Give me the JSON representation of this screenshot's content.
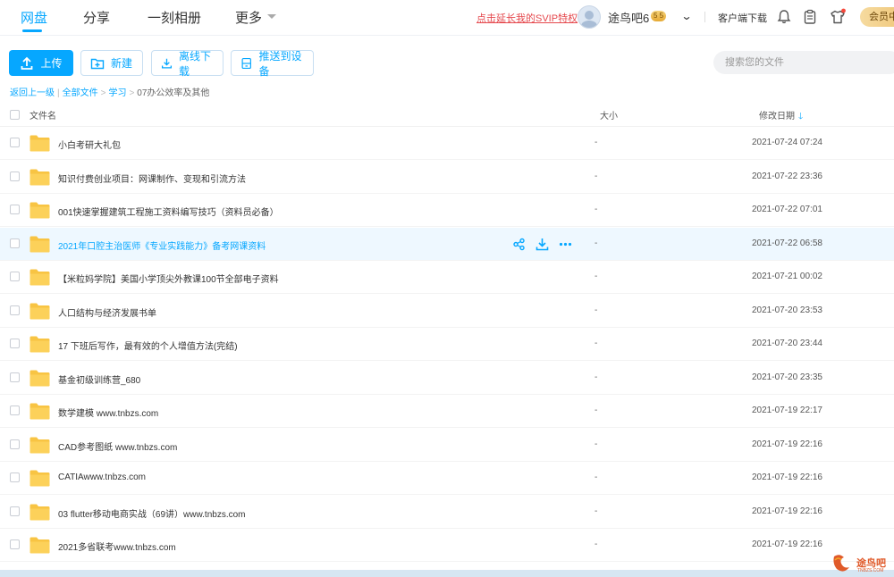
{
  "nav": {
    "items": [
      {
        "label": "网盘",
        "active": true
      },
      {
        "label": "分享",
        "active": false
      },
      {
        "label": "一刻相册",
        "active": false
      },
      {
        "label": "更多",
        "active": false
      }
    ]
  },
  "header": {
    "svip_promo": "点击延长我的SVIP特权",
    "username": "途鸟吧6",
    "vip_level": "5 5",
    "client_download": "客户端下载",
    "member_button": "会员中"
  },
  "toolbar": {
    "upload": "上传",
    "new_folder": "新建",
    "offline_download": "离线下载",
    "push_to_device": "推送到设备",
    "search_placeholder": "搜索您的文件"
  },
  "breadcrumb": {
    "back": "返回上一级",
    "all_files": "全部文件",
    "level1": "学习",
    "current": "07办公效率及其他"
  },
  "table": {
    "col_name": "文件名",
    "col_size": "大小",
    "col_date": "修改日期",
    "rows": [
      {
        "name": "小白考研大礼包",
        "size": "-",
        "date": "2021-07-24 07:24"
      },
      {
        "name": "知识付费创业项目：网课制作、变现和引流方法",
        "size": "-",
        "date": "2021-07-22 23:36"
      },
      {
        "name": "001快速掌握建筑工程施工资料编写技巧（资料员必备）",
        "size": "-",
        "date": "2021-07-22 07:01"
      },
      {
        "name": "2021年口腔主治医师《专业实践能力》备考网课资料",
        "size": "-",
        "date": "2021-07-22 06:58"
      },
      {
        "name": "【米粒妈学院】美国小学顶尖外教课100节全部电子资料",
        "size": "-",
        "date": "2021-07-21 00:02"
      },
      {
        "name": "人口结构与经济发展书单",
        "size": "-",
        "date": "2021-07-20 23:53"
      },
      {
        "name": "17 下班后写作，最有效的个人增值方法(完结)",
        "size": "-",
        "date": "2021-07-20 23:44"
      },
      {
        "name": "基金初级训练营_680",
        "size": "-",
        "date": "2021-07-20 23:35"
      },
      {
        "name": "数学建模 www.tnbzs.com",
        "size": "-",
        "date": "2021-07-19 22:17"
      },
      {
        "name": "CAD参考图纸 www.tnbzs.com",
        "size": "-",
        "date": "2021-07-19 22:16"
      },
      {
        "name": "CATIAwww.tnbzs.com",
        "size": "-",
        "date": "2021-07-19 22:16"
      },
      {
        "name": "03 flutter移动电商实战（69讲）www.tnbzs.com",
        "size": "-",
        "date": "2021-07-19 22:16"
      },
      {
        "name": "2021多省联考www.tnbzs.com",
        "size": "-",
        "date": "2021-07-19 22:16"
      }
    ]
  },
  "watermark": {
    "text": "途鸟吧",
    "url": "TNBZS.COM"
  },
  "colors": {
    "accent": "#06a7ff",
    "folder": "#f8c443",
    "promo": "#e5484d",
    "hover_row": "#eef8ff"
  },
  "icons": [
    "upload-icon",
    "new-folder-icon",
    "download-icon",
    "device-icon",
    "bell-icon",
    "clipboard-icon",
    "shirt-icon",
    "share-icon",
    "more-icon",
    "folder-icon",
    "sort-down-icon"
  ]
}
